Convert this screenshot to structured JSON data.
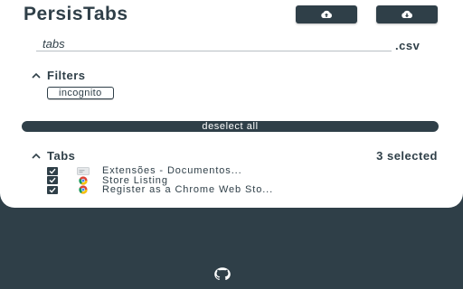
{
  "app": {
    "title": "PersisTabs"
  },
  "toolbar": {
    "upload_icon": "cloud-upload-icon",
    "download_icon": "cloud-download-icon"
  },
  "export": {
    "filename_value": "tabs",
    "extension": ".csv"
  },
  "filters": {
    "heading": "Filters",
    "items": [
      {
        "label": "incognito"
      }
    ]
  },
  "actions": {
    "deselect_label": "deselect all"
  },
  "tabs": {
    "heading": "Tabs",
    "selected_text": "3 selected",
    "items": [
      {
        "title": "Extensões - Documentos...",
        "checked": true,
        "favicon": "extensions-favicon"
      },
      {
        "title": "Store Listing",
        "checked": true,
        "favicon": "chrome-favicon"
      },
      {
        "title": "Register as a Chrome Web Sto...",
        "checked": true,
        "favicon": "chrome-favicon"
      }
    ]
  },
  "footer": {
    "icon": "github-icon"
  },
  "colors": {
    "primary": "#2f3f48",
    "panel": "#ffffff"
  }
}
